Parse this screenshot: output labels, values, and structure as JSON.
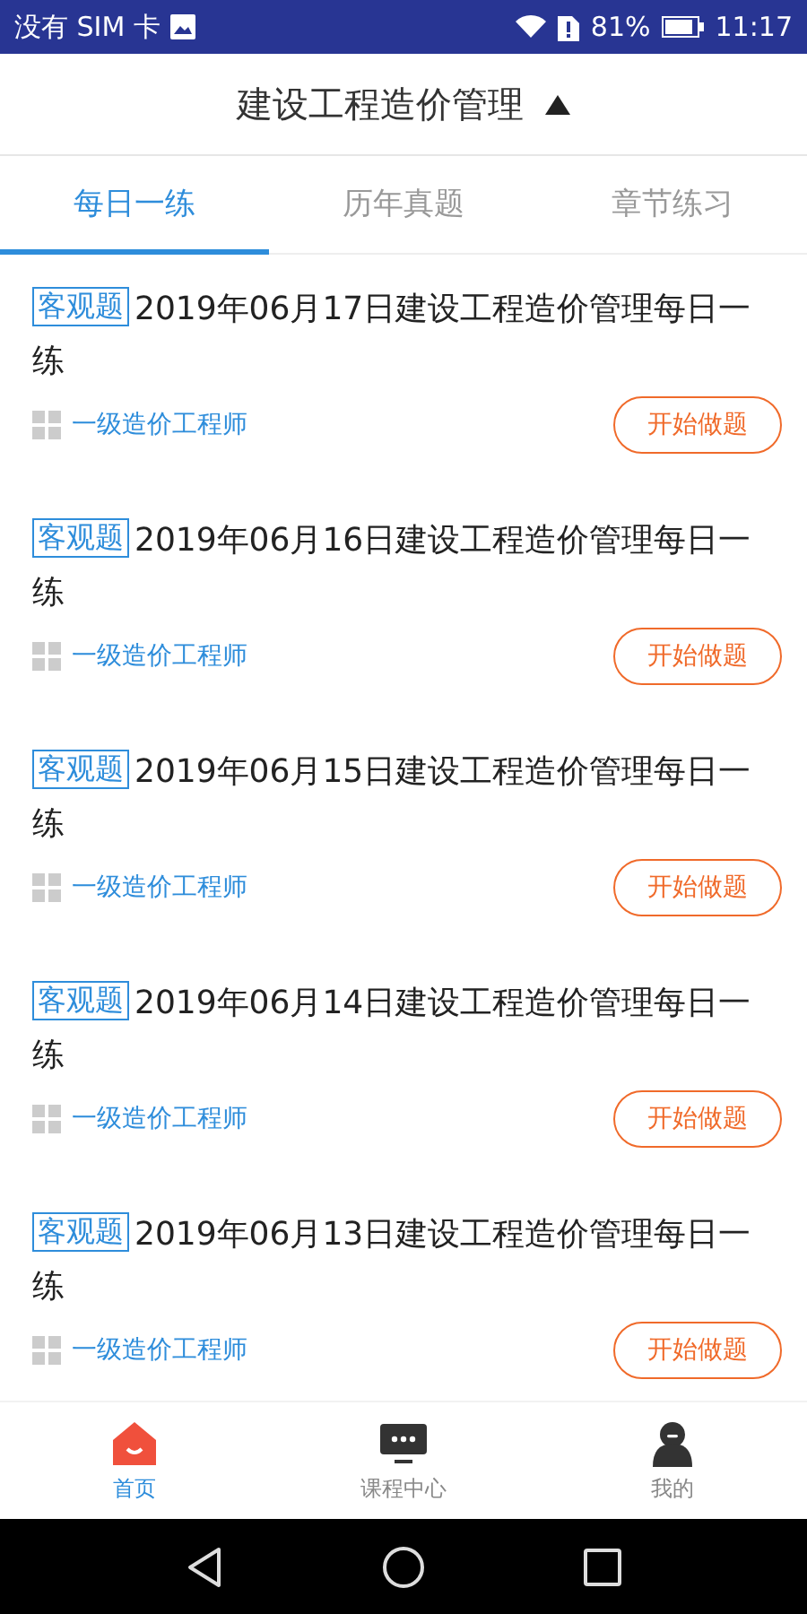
{
  "status_bar": {
    "carrier": "没有 SIM 卡",
    "battery": "81%",
    "time": "11:17"
  },
  "header": {
    "title": "建设工程造价管理",
    "expanded": true
  },
  "tabs": [
    {
      "label": "每日一练",
      "selected": true
    },
    {
      "label": "历年真题",
      "selected": false
    },
    {
      "label": "章节练习",
      "selected": false
    }
  ],
  "items": [
    {
      "tag": "客观题",
      "title": "2019年06月17日建设工程造价管理每日一练",
      "category": "一级造价工程师",
      "button": "开始做题"
    },
    {
      "tag": "客观题",
      "title": "2019年06月16日建设工程造价管理每日一练",
      "category": "一级造价工程师",
      "button": "开始做题"
    },
    {
      "tag": "客观题",
      "title": "2019年06月15日建设工程造价管理每日一练",
      "category": "一级造价工程师",
      "button": "开始做题"
    },
    {
      "tag": "客观题",
      "title": "2019年06月14日建设工程造价管理每日一练",
      "category": "一级造价工程师",
      "button": "开始做题"
    },
    {
      "tag": "客观题",
      "title": "2019年06月13日建设工程造价管理每日一练",
      "category": "一级造价工程师",
      "button": "开始做题"
    }
  ],
  "bottom_nav": [
    {
      "kind": "home",
      "label": "首页",
      "selected": true
    },
    {
      "kind": "course",
      "label": "课程中心",
      "selected": false
    },
    {
      "kind": "profile",
      "label": "我的",
      "selected": false
    }
  ]
}
